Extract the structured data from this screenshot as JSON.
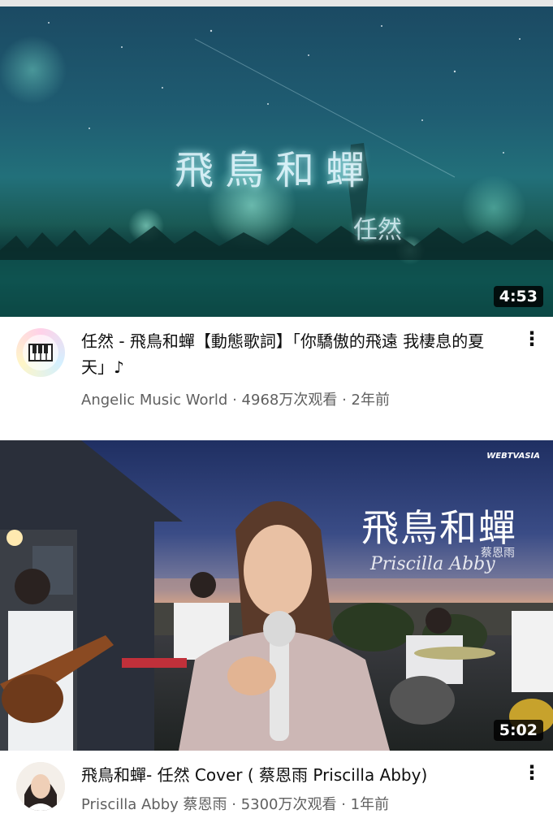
{
  "videos": [
    {
      "overlay_title": "飛鳥和蟬",
      "overlay_artist": "任然",
      "duration": "4:53",
      "title": "任然 - 飛鳥和蟬【動態歌詞】「你驕傲的飛遠 我棲息的夏天」♪",
      "channel": "Angelic Music World",
      "views": "4968万次观看",
      "age": "2年前",
      "menu": "⋮"
    },
    {
      "overlay_title": "飛鳥和蟬",
      "overlay_artist_latin": "Priscilla Abby",
      "overlay_artist_cjk": "蔡恩雨",
      "watermark": "WEBTVASIA",
      "duration": "5:02",
      "title": "飛鳥和蟬- 任然 Cover ( 蔡恩雨 Priscilla Abby)",
      "channel": "Priscilla Abby 蔡恩雨",
      "views": "5300万次观看",
      "age": "1年前",
      "menu": "⋮"
    }
  ],
  "separator": " · ",
  "colors": {
    "title_text": "#0f0f0f",
    "meta_text": "#606060",
    "duration_bg": "#000000"
  }
}
